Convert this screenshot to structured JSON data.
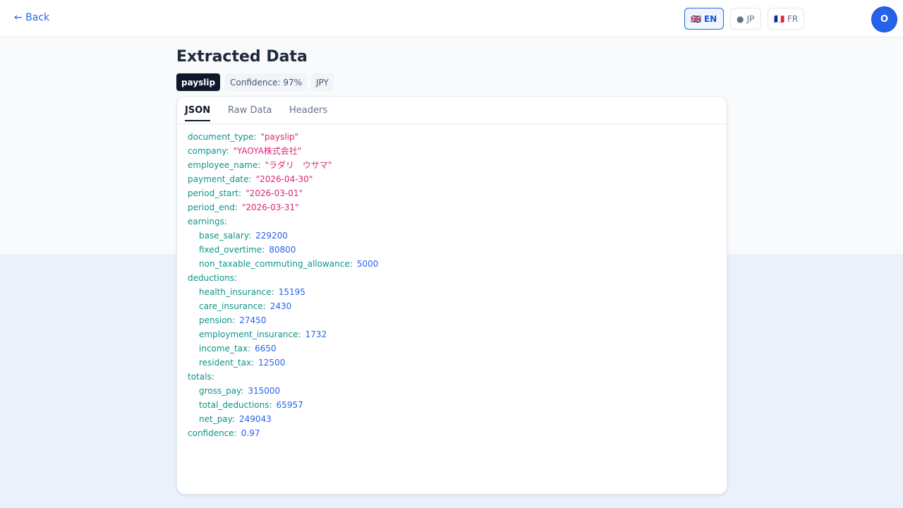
{
  "header": {
    "back_label": "← Back",
    "languages": [
      {
        "flag": "🇬🇧",
        "code": "EN",
        "active": true
      },
      {
        "flag": "●",
        "code": "JP",
        "active": false
      },
      {
        "flag": "🇫🇷",
        "code": "FR",
        "active": false
      }
    ],
    "avatar_initial": "O",
    "accent_color": "#2563eb"
  },
  "main": {
    "title": "Extracted Data",
    "badges": {
      "document_type": "payslip",
      "confidence": "Confidence: 97%",
      "currency": "JPY"
    },
    "tabs": [
      {
        "label": "JSON",
        "active": true
      },
      {
        "label": "Raw Data",
        "active": false
      },
      {
        "label": "Headers",
        "active": false
      }
    ],
    "json": {
      "document_type": {
        "key": "document_type:",
        "value": "\"payslip\""
      },
      "company": {
        "key": "company:",
        "value": "\"YAOYA株式会社\""
      },
      "employee_name": {
        "key": "employee_name:",
        "value": "\"ラダリ　ウサマ\""
      },
      "payment_date": {
        "key": "payment_date:",
        "value": "\"2026-04-30\""
      },
      "period_start": {
        "key": "period_start:",
        "value": "\"2026-03-01\""
      },
      "period_end": {
        "key": "period_end:",
        "value": "\"2026-03-31\""
      },
      "earnings_key": "earnings:",
      "base_salary": {
        "key": "base_salary:",
        "value": "229200"
      },
      "fixed_overtime": {
        "key": "fixed_overtime:",
        "value": "80800"
      },
      "commuting": {
        "key": "non_taxable_commuting_allowance:",
        "value": "5000"
      },
      "deductions_key": "deductions:",
      "health_insurance": {
        "key": "health_insurance:",
        "value": "15195"
      },
      "care_insurance": {
        "key": "care_insurance:",
        "value": "2430"
      },
      "pension": {
        "key": "pension:",
        "value": "27450"
      },
      "employment_insurance": {
        "key": "employment_insurance:",
        "value": "1732"
      },
      "income_tax": {
        "key": "income_tax:",
        "value": "6650"
      },
      "resident_tax": {
        "key": "resident_tax:",
        "value": "12500"
      },
      "totals_key": "totals:",
      "gross_pay": {
        "key": "gross_pay:",
        "value": "315000"
      },
      "total_deductions": {
        "key": "total_deductions:",
        "value": "65957"
      },
      "net_pay": {
        "key": "net_pay:",
        "value": "249043"
      },
      "confidence": {
        "key": "confidence:",
        "value": "0.97"
      }
    }
  }
}
